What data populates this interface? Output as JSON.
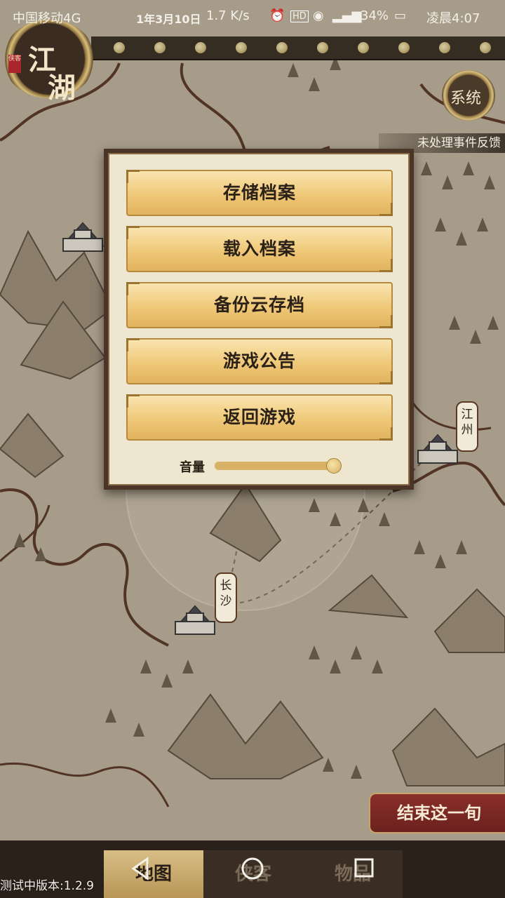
{
  "status_bar": {
    "carrier": "中国移动4G",
    "date_overlay": "1年3月10日",
    "net_speed": "1.7 K/s",
    "battery": "34%",
    "time": "凌晨4:07"
  },
  "header": {
    "emblem_title": [
      "江",
      "湖"
    ],
    "emblem_seal": "侠客"
  },
  "system_button": "系统",
  "feedback_label": "未处理事件反馈",
  "cities": [
    {
      "name": "江州"
    },
    {
      "name": "长沙"
    }
  ],
  "dialog": {
    "buttons": [
      {
        "label": "存储档案"
      },
      {
        "label": "载入档案"
      },
      {
        "label": "备份云存档"
      },
      {
        "label": "游戏公告"
      },
      {
        "label": "返回游戏"
      }
    ],
    "volume_label": "音量",
    "volume_level": 0.98
  },
  "end_turn_button": "结束这一旬",
  "bottom_tabs": [
    {
      "label": "地图",
      "active": true
    },
    {
      "label": "侠客",
      "active": false
    },
    {
      "label": "物品",
      "active": false
    }
  ],
  "version_text": "测试中版本:1.2.9",
  "colors": {
    "dialog_bg": "#efe6cf",
    "button_gold": "#efc878",
    "end_turn_red": "#8a2f2a",
    "frame_brown": "#4a3526"
  }
}
